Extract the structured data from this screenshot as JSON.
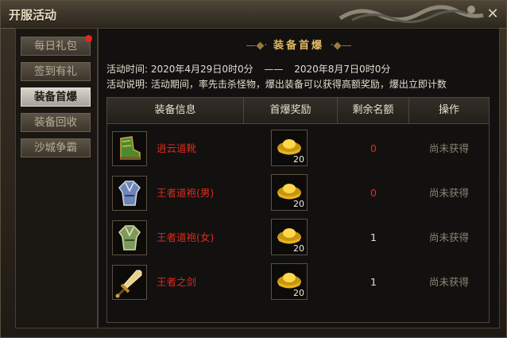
{
  "window": {
    "title": "开服活动"
  },
  "sidebar": {
    "tabs": [
      {
        "label": "每日礼包",
        "active": false,
        "has_notification": true
      },
      {
        "label": "签到有礼",
        "active": false,
        "has_notification": false
      },
      {
        "label": "装备首爆",
        "active": true,
        "has_notification": false
      },
      {
        "label": "装备回收",
        "active": false,
        "has_notification": false
      },
      {
        "label": "沙城争霸",
        "active": false,
        "has_notification": false
      }
    ]
  },
  "panel": {
    "section_title": "装备首爆",
    "time_label": "活动时间:",
    "time_start": "2020年4月29日0时0分",
    "time_sep": "——",
    "time_end": "2020年8月7日0时0分",
    "desc_label": "活动说明:",
    "desc_text": "活动期间，率先击杀怪物，爆出装备可以获得高额奖励，爆出立即计数"
  },
  "table": {
    "headers": [
      "装备信息",
      "首爆奖励",
      "剩余名额",
      "操作"
    ],
    "rows": [
      {
        "item_name": "逍云道靴",
        "item_icon": "boots-icon",
        "reward_icon": "gold-ingot-icon",
        "reward_count": "20",
        "remaining": "0",
        "status": "尚未获得"
      },
      {
        "item_name": "王者道袍(男)",
        "item_icon": "robe-icon",
        "reward_icon": "gold-ingot-icon",
        "reward_count": "20",
        "remaining": "0",
        "status": "尚未获得"
      },
      {
        "item_name": "王者道袍(女)",
        "item_icon": "robe-icon",
        "reward_icon": "gold-ingot-icon",
        "reward_count": "20",
        "remaining": "1",
        "status": "尚未获得"
      },
      {
        "item_name": "王者之剑",
        "item_icon": "sword-icon",
        "reward_icon": "gold-ingot-icon",
        "reward_count": "20",
        "remaining": "1",
        "status": "尚未获得"
      }
    ]
  },
  "colors": {
    "item_name": "#e02a1c",
    "remaining_zero": "#e02a1c",
    "remaining_nonzero": "#e8e2d2",
    "status": "#8c8674",
    "title_accent": "#e4b962"
  }
}
